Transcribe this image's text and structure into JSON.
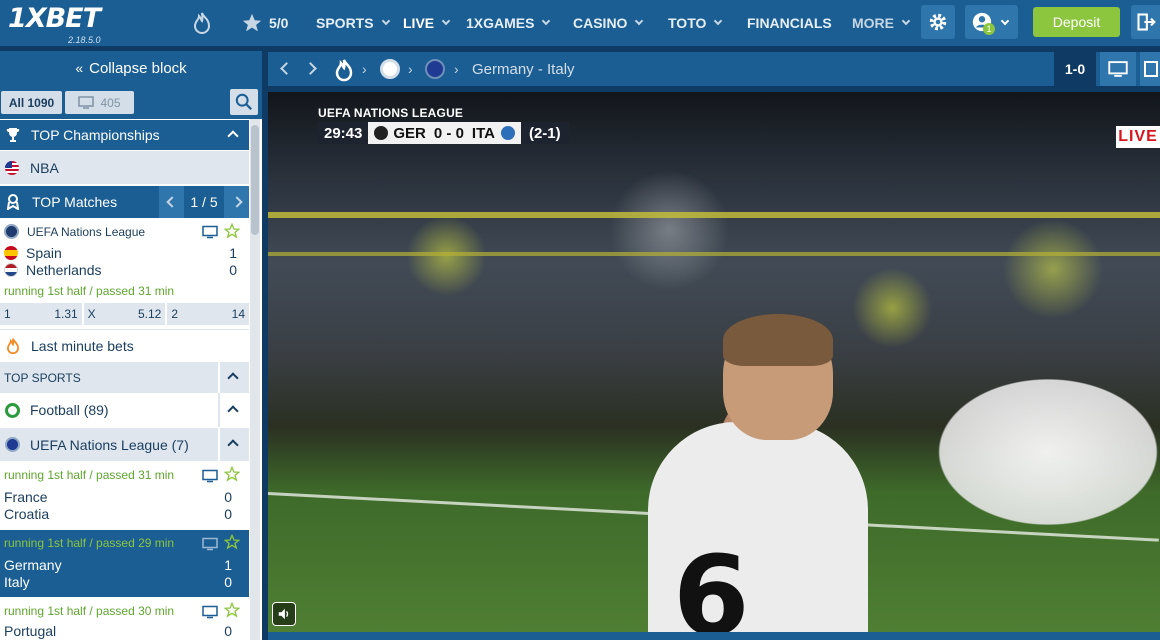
{
  "header": {
    "logo": "1XBET",
    "version": "2.18.5.0",
    "favorites_count": "5/0",
    "nav": [
      "SPORTS",
      "LIVE",
      "1XGAMES",
      "CASINO",
      "TOTO",
      "FINANCIALS",
      "MORE"
    ],
    "notification_count": "1",
    "deposit_label": "Deposit"
  },
  "sidebar": {
    "collapse_label": "Collapse block",
    "tab_all": "All 1090",
    "tab_tv": "405",
    "top_championships": "TOP Championships",
    "nba": "NBA",
    "top_matches": "TOP Matches",
    "top_matches_page": "1 / 5",
    "featured": {
      "league": "UEFA Nations League",
      "team1": "Spain",
      "score1": "1",
      "team2": "Netherlands",
      "score2": "0",
      "status": "running 1st half / passed 31 min",
      "odds": [
        {
          "label": "1",
          "value": "1.31"
        },
        {
          "label": "X",
          "value": "5.12"
        },
        {
          "label": "2",
          "value": "14"
        }
      ]
    },
    "last_minute": "Last minute bets",
    "top_sports": "TOP SPORTS",
    "football": "Football (89)",
    "league_group": "UEFA Nations League (7)",
    "matches": [
      {
        "status": "running 1st half / passed 31 min",
        "team1": "France",
        "score1": "0",
        "team2": "Croatia",
        "score2": "0"
      },
      {
        "status": "running 1st half / passed 29 min",
        "team1": "Germany",
        "score1": "1",
        "team2": "Italy",
        "score2": "0"
      },
      {
        "status": "running 1st half / passed 30 min",
        "team1": "Portugal",
        "score1": "0"
      }
    ]
  },
  "breadcrumb": {
    "match": "Germany - Italy",
    "score": "1-0"
  },
  "video": {
    "league": "UEFA NATIONS LEAGUE",
    "time": "29:43",
    "home": "GER",
    "score": "0 - 0",
    "away": "ITA",
    "aggregate": "(2-1)",
    "live": "LIVE",
    "shirt_number": "6"
  },
  "colors": {
    "primary": "#1a5e94",
    "dark": "#0f3a63",
    "accent_green": "#8cc63f",
    "status_green": "#5fa52f",
    "live_red": "#d8141c"
  }
}
